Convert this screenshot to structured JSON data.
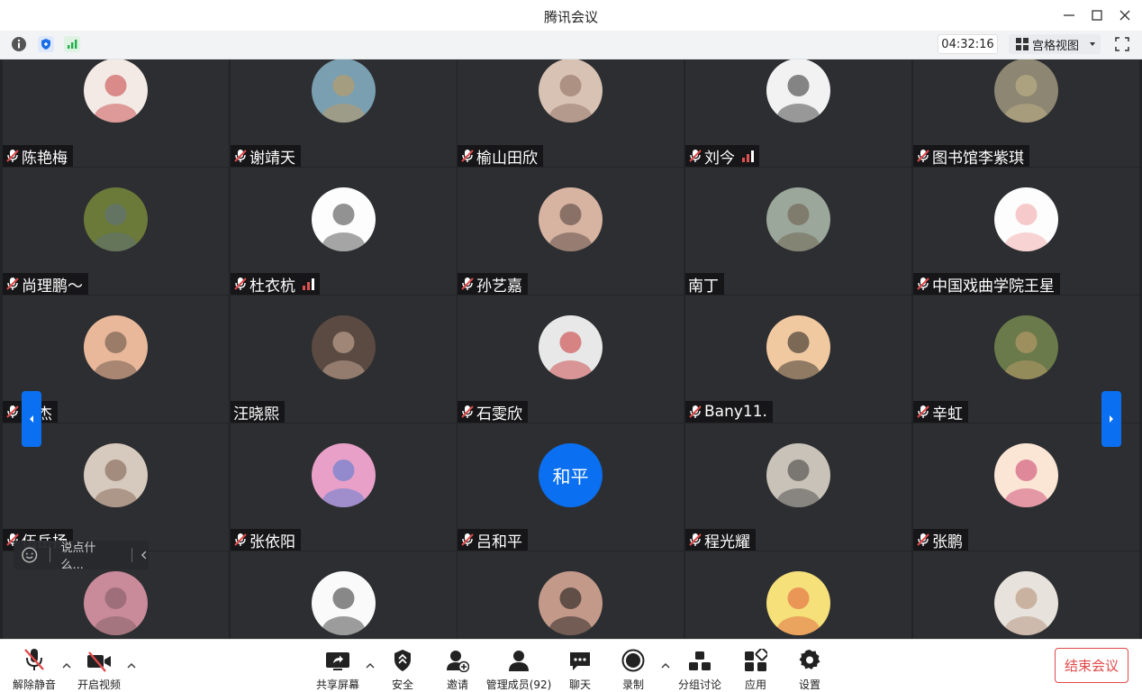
{
  "window": {
    "title": "腾讯会议"
  },
  "infobar": {
    "timer": "04:32:16",
    "view_label": "宫格视图"
  },
  "participants": [
    {
      "name": "陈艳梅",
      "muted": true,
      "signal": false,
      "avatar_color": "#f3eae6",
      "avatar_accent": "#c43a3a"
    },
    {
      "name": "谢靖天",
      "muted": true,
      "signal": false,
      "avatar_color": "#7a9fb0",
      "avatar_accent": "#c89a5a"
    },
    {
      "name": "榆山田欣",
      "muted": true,
      "signal": false,
      "avatar_color": "#d8c2b4",
      "avatar_accent": "#8a6a5a"
    },
    {
      "name": "刘今",
      "muted": true,
      "signal": true,
      "avatar_color": "#f2f2f2",
      "avatar_accent": "#2a2a2a"
    },
    {
      "name": "图书馆李紫琪",
      "muted": true,
      "signal": false,
      "avatar_color": "#8c8672",
      "avatar_accent": "#c7b98a"
    },
    {
      "name": "尚理鹏～",
      "muted": true,
      "signal": false,
      "avatar_color": "#6b7a38",
      "avatar_accent": "#5e6f86"
    },
    {
      "name": "杜衣杭",
      "muted": true,
      "signal": true,
      "avatar_color": "#fdfdfd",
      "avatar_accent": "#3a3a3a"
    },
    {
      "name": "孙艺嘉",
      "muted": true,
      "signal": false,
      "avatar_color": "#d7b3a2",
      "avatar_accent": "#4a3a36"
    },
    {
      "name": "南丁",
      "muted": false,
      "signal": false,
      "avatar_color": "#9aa79a",
      "avatar_accent": "#6b5a48"
    },
    {
      "name": "中国戏曲学院王星",
      "muted": true,
      "signal": false,
      "avatar_color": "#fdfdfd",
      "avatar_accent": "#f0a0a0"
    },
    {
      "name": "陈杰",
      "muted": true,
      "signal": false,
      "avatar_color": "#e9b89a",
      "avatar_accent": "#5a4a42"
    },
    {
      "name": "汪晓熙",
      "muted": false,
      "signal": false,
      "avatar_color": "#5a4a42",
      "avatar_accent": "#d9b8a2"
    },
    {
      "name": "石雯欣",
      "muted": true,
      "signal": false,
      "avatar_color": "#e8e8e8",
      "avatar_accent": "#c83030"
    },
    {
      "name": "Bany11.",
      "muted": true,
      "signal": false,
      "avatar_color": "#f1c9a0",
      "avatar_accent": "#1a1a1a"
    },
    {
      "name": "辛虹",
      "muted": true,
      "signal": false,
      "avatar_color": "#6a7a4a",
      "avatar_accent": "#c8a070"
    },
    {
      "name": "伍岳扬",
      "muted": true,
      "signal": false,
      "avatar_color": "#d6c9bd",
      "avatar_accent": "#7a5a48"
    },
    {
      "name": "张依阳",
      "muted": true,
      "signal": false,
      "avatar_color": "#e8a0c8",
      "avatar_accent": "#4a78d0"
    },
    {
      "name": "吕和平",
      "muted": true,
      "signal": false,
      "avatar_text": "和平"
    },
    {
      "name": "程光耀",
      "muted": true,
      "signal": false,
      "avatar_color": "#c8c2b8",
      "avatar_accent": "#3a3a3a"
    },
    {
      "name": "张鹏",
      "muted": true,
      "signal": false,
      "avatar_color": "#fbe6d6",
      "avatar_accent": "#c83a6a"
    },
    {
      "name": "",
      "muted": false,
      "signal": false,
      "avatar_color": "#c98a9a",
      "avatar_accent": "#7a5a60"
    },
    {
      "name": "",
      "muted": false,
      "signal": false,
      "avatar_color": "#fafafa",
      "avatar_accent": "#2a2a2a"
    },
    {
      "name": "",
      "muted": false,
      "signal": false,
      "avatar_color": "#c39a8a",
      "avatar_accent": "#111111"
    },
    {
      "name": "",
      "muted": false,
      "signal": false,
      "avatar_color": "#f5e07a",
      "avatar_accent": "#e05a3a"
    },
    {
      "name": "",
      "muted": false,
      "signal": false,
      "avatar_color": "#e8e2dc",
      "avatar_accent": "#b08a70"
    }
  ],
  "chat": {
    "placeholder": "说点什么..."
  },
  "toolbar": {
    "unmute": "解除静音",
    "start_video": "开启视频",
    "share": "共享屏幕",
    "security": "安全",
    "invite": "邀请",
    "manage": "管理成员(92)",
    "chat": "聊天",
    "record": "录制",
    "breakout": "分组讨论",
    "apps": "应用",
    "settings": "设置",
    "end": "结束会议"
  },
  "colors": {
    "accent": "#0a6ff0",
    "danger": "#e04a4a",
    "grid_bg": "#232427",
    "tile_bg": "#2d2e31"
  },
  "icons": [
    "info-icon",
    "shield-icon",
    "signal-icon",
    "grid-view-icon",
    "fullscreen-icon",
    "mic-muted-icon",
    "video-off-icon",
    "share-screen-icon",
    "security-icon",
    "invite-icon",
    "members-icon",
    "chat-icon",
    "record-icon",
    "breakout-icon",
    "apps-icon",
    "settings-icon"
  ]
}
